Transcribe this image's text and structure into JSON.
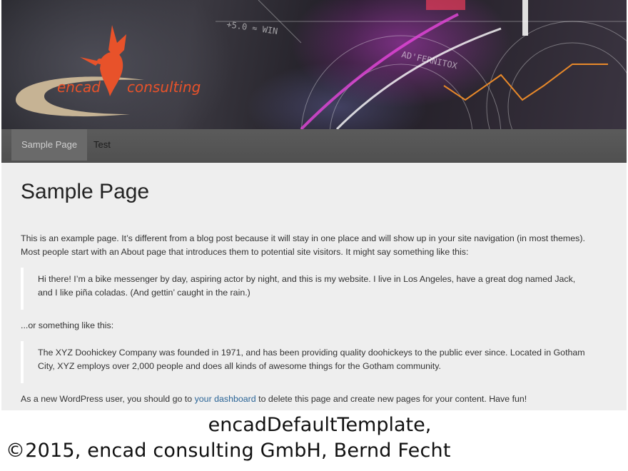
{
  "header": {
    "logo_left": "encad",
    "logo_right": "consulting",
    "colors": {
      "logo": "#e8522a",
      "swoosh": "#c6b394"
    }
  },
  "nav": {
    "items": [
      {
        "label": "Sample Page",
        "active": true
      },
      {
        "label": "Test",
        "active": false
      }
    ]
  },
  "page": {
    "title": "Sample Page",
    "intro_line1": "This is an example page. It’s different from a blog post because it will stay in one place and will show up in your site navigation (in most themes).",
    "intro_line2": "Most people start with an About page that introduces them to potential site visitors. It might say something like this:",
    "quote1_line1": "Hi there! I’m a bike messenger by day, aspiring actor by night, and this is my website. I live in Los Angeles, have a great dog named Jack,",
    "quote1_line2": "and I like piña coladas. (And gettin’ caught in the rain.)",
    "or_text": "...or something like this:",
    "quote2_line1": "The XYZ Doohickey Company was founded in 1971, and has been providing quality doohickeys to the public ever since. Located in Gotham",
    "quote2_line2": "City, XYZ employs over 2,000 people and does all kinds of awesome things for the Gotham community.",
    "closing_before": "As a new WordPress user, you should go to ",
    "closing_link": "your dashboard",
    "closing_after": " to delete this page and create new pages for your content. Have fun!"
  },
  "caption": {
    "line1": "encadDefaultTemplate,",
    "line2": "©2015, encad consulting GmbH, Bernd Fecht"
  }
}
